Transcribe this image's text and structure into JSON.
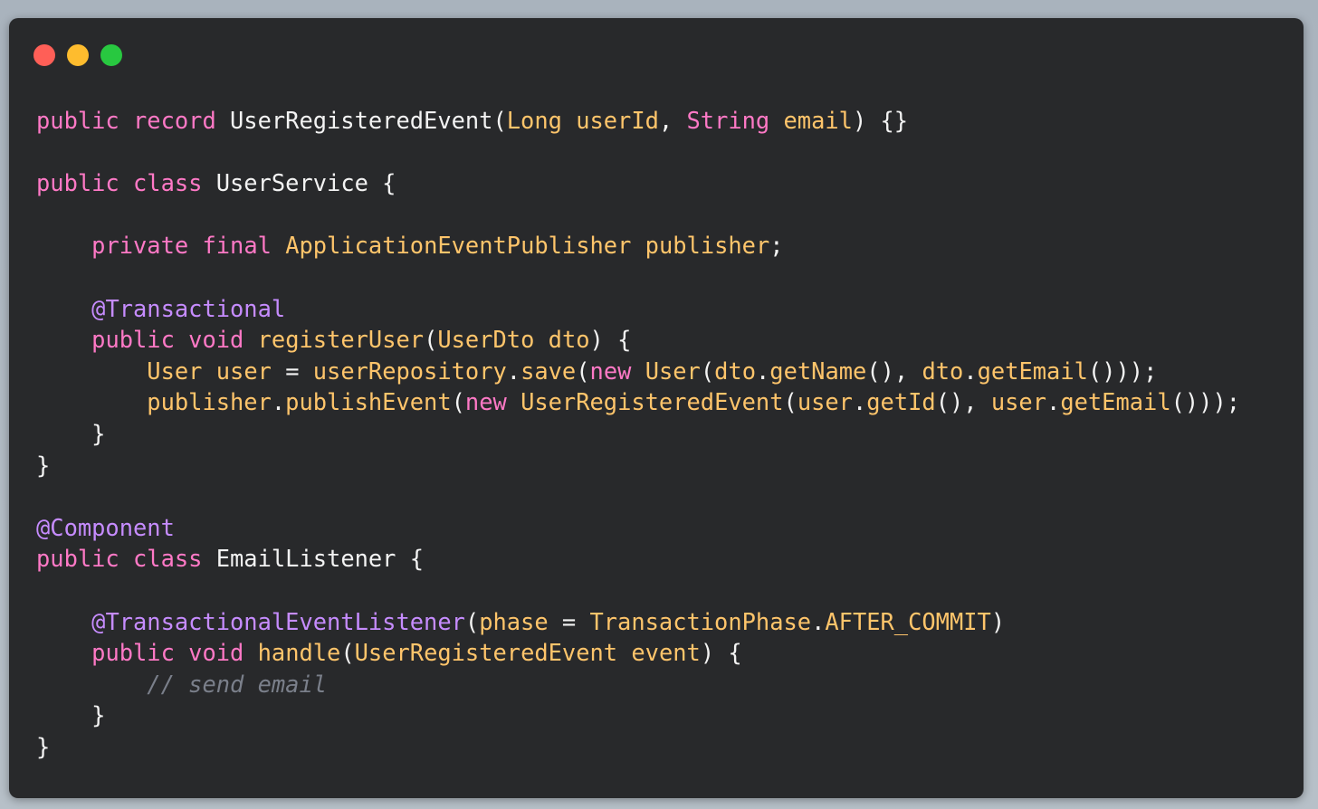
{
  "window": {
    "controls": [
      {
        "name": "close",
        "color": "#ff5f57"
      },
      {
        "name": "minimize",
        "color": "#febc2e"
      },
      {
        "name": "zoom",
        "color": "#28c840"
      }
    ]
  },
  "colors": {
    "background": "#28292b",
    "keyword": "#ff79c6",
    "type": "#ffc56b",
    "annotation": "#c68cff",
    "plain": "#f3f3f3",
    "comment": "#7a7f8a"
  },
  "code": {
    "language": "java",
    "lines": [
      [
        [
          "kw",
          "public"
        ],
        [
          "pl",
          " "
        ],
        [
          "kw",
          "record"
        ],
        [
          "pl",
          " UserRegisteredEvent("
        ],
        [
          "ty",
          "Long"
        ],
        [
          "pl",
          " "
        ],
        [
          "ty",
          "userId"
        ],
        [
          "pl",
          ", "
        ],
        [
          "kw",
          "String"
        ],
        [
          "pl",
          " "
        ],
        [
          "ty",
          "email"
        ],
        [
          "pl",
          ") {}"
        ]
      ],
      [],
      [
        [
          "kw",
          "public"
        ],
        [
          "pl",
          " "
        ],
        [
          "kw",
          "class"
        ],
        [
          "pl",
          " UserService {"
        ]
      ],
      [],
      [
        [
          "pl",
          "    "
        ],
        [
          "kw",
          "private"
        ],
        [
          "pl",
          " "
        ],
        [
          "kw",
          "final"
        ],
        [
          "pl",
          " "
        ],
        [
          "ty",
          "ApplicationEventPublisher"
        ],
        [
          "pl",
          " "
        ],
        [
          "ty",
          "publisher"
        ],
        [
          "pl",
          ";"
        ]
      ],
      [],
      [
        [
          "pl",
          "    "
        ],
        [
          "an",
          "@Transactional"
        ]
      ],
      [
        [
          "pl",
          "    "
        ],
        [
          "kw",
          "public"
        ],
        [
          "pl",
          " "
        ],
        [
          "kw",
          "void"
        ],
        [
          "pl",
          " "
        ],
        [
          "fn",
          "registerUser"
        ],
        [
          "pl",
          "("
        ],
        [
          "ty",
          "UserDto"
        ],
        [
          "pl",
          " "
        ],
        [
          "ty",
          "dto"
        ],
        [
          "pl",
          ") {"
        ]
      ],
      [
        [
          "pl",
          "        "
        ],
        [
          "ty",
          "User"
        ],
        [
          "pl",
          " "
        ],
        [
          "ty",
          "user"
        ],
        [
          "pl",
          " = "
        ],
        [
          "ty",
          "userRepository"
        ],
        [
          "pl",
          "."
        ],
        [
          "fn",
          "save"
        ],
        [
          "pl",
          "("
        ],
        [
          "kw",
          "new"
        ],
        [
          "pl",
          " "
        ],
        [
          "ty",
          "User"
        ],
        [
          "pl",
          "("
        ],
        [
          "ty",
          "dto"
        ],
        [
          "pl",
          "."
        ],
        [
          "fn",
          "getName"
        ],
        [
          "pl",
          "(), "
        ],
        [
          "ty",
          "dto"
        ],
        [
          "pl",
          "."
        ],
        [
          "fn",
          "getEmail"
        ],
        [
          "pl",
          "()));"
        ]
      ],
      [
        [
          "pl",
          "        "
        ],
        [
          "ty",
          "publisher"
        ],
        [
          "pl",
          "."
        ],
        [
          "fn",
          "publishEvent"
        ],
        [
          "pl",
          "("
        ],
        [
          "kw",
          "new"
        ],
        [
          "pl",
          " "
        ],
        [
          "ty",
          "UserRegisteredEvent"
        ],
        [
          "pl",
          "("
        ],
        [
          "ty",
          "user"
        ],
        [
          "pl",
          "."
        ],
        [
          "fn",
          "getId"
        ],
        [
          "pl",
          "(), "
        ],
        [
          "ty",
          "user"
        ],
        [
          "pl",
          "."
        ],
        [
          "fn",
          "getEmail"
        ],
        [
          "pl",
          "()));"
        ]
      ],
      [
        [
          "pl",
          "    }"
        ]
      ],
      [
        [
          "pl",
          "}"
        ]
      ],
      [],
      [
        [
          "an",
          "@Component"
        ]
      ],
      [
        [
          "kw",
          "public"
        ],
        [
          "pl",
          " "
        ],
        [
          "kw",
          "class"
        ],
        [
          "pl",
          " EmailListener {"
        ]
      ],
      [],
      [
        [
          "pl",
          "    "
        ],
        [
          "an",
          "@TransactionalEventListener"
        ],
        [
          "pl",
          "("
        ],
        [
          "ty",
          "phase"
        ],
        [
          "pl",
          " = "
        ],
        [
          "ty",
          "TransactionPhase"
        ],
        [
          "pl",
          "."
        ],
        [
          "ty",
          "AFTER_COMMIT"
        ],
        [
          "pl",
          ")"
        ]
      ],
      [
        [
          "pl",
          "    "
        ],
        [
          "kw",
          "public"
        ],
        [
          "pl",
          " "
        ],
        [
          "kw",
          "void"
        ],
        [
          "pl",
          " "
        ],
        [
          "fn",
          "handle"
        ],
        [
          "pl",
          "("
        ],
        [
          "ty",
          "UserRegisteredEvent"
        ],
        [
          "pl",
          " "
        ],
        [
          "ty",
          "event"
        ],
        [
          "pl",
          ") {"
        ]
      ],
      [
        [
          "pl",
          "        "
        ],
        [
          "cm",
          "// send email"
        ]
      ],
      [
        [
          "pl",
          "    }"
        ]
      ],
      [
        [
          "pl",
          "}"
        ]
      ]
    ]
  }
}
